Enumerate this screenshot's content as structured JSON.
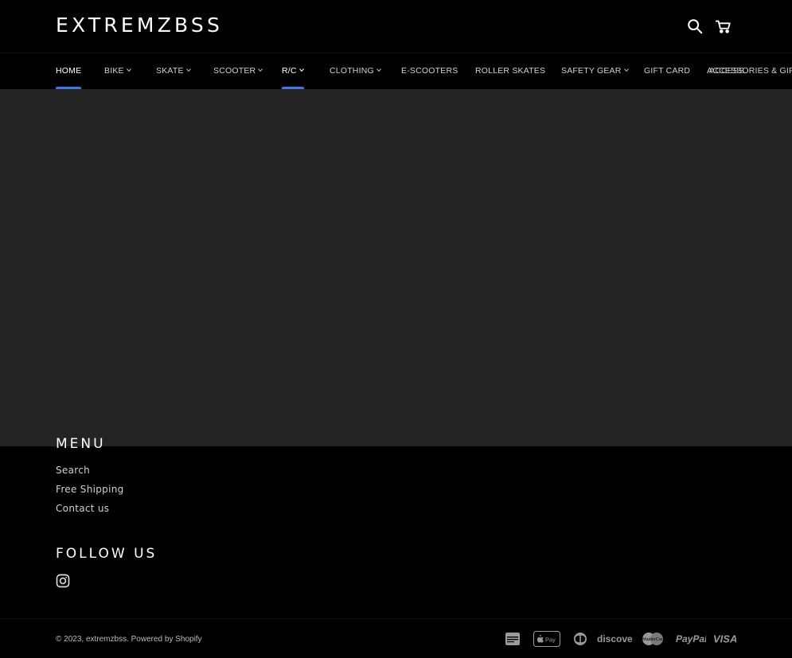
{
  "header": {
    "logo": "EXTREMZBSS",
    "icons": [
      "search-icon",
      "cart-icon"
    ]
  },
  "nav": {
    "items": [
      {
        "label": "HOME",
        "active": true,
        "dropdown": false
      },
      {
        "label": "BIKE",
        "active": false,
        "dropdown": true
      },
      {
        "label": "SKATE",
        "active": false,
        "dropdown": true
      },
      {
        "label": "SCOOTER",
        "active": false,
        "dropdown": true
      },
      {
        "label": "R/C",
        "active": true,
        "dropdown": true
      },
      {
        "label": "CLOTHING",
        "active": false,
        "dropdown": true
      },
      {
        "label": "E-SCOOTERS",
        "active": false,
        "dropdown": false
      },
      {
        "label": "ROLLER SKATES",
        "active": false,
        "dropdown": false
      },
      {
        "label": "SAFETY GEAR",
        "active": false,
        "dropdown": true
      },
      {
        "label": "GIFT CARD",
        "active": false,
        "dropdown": false
      },
      {
        "label": "ACCESSORIES & GIFTS",
        "active": false,
        "dropdown": false
      },
      {
        "label": "ACCESS",
        "active": false,
        "dropdown": false
      }
    ],
    "active_color": "#3d7ae8"
  },
  "footer": {
    "menu_heading": "MENU",
    "menu_links": [
      "Search",
      "Free Shipping",
      "Contact us"
    ],
    "follow_heading": "FOLLOW US",
    "social": [
      "instagram-icon"
    ],
    "copyright_prefix": "© 2023, ",
    "store_link": "extremzbss",
    "powered_by": ". Powered by Shopify",
    "payment_icons": [
      "american-express-icon",
      "apple-pay-icon",
      "diners-club-icon",
      "discover-icon",
      "mastercard-icon",
      "paypal-icon",
      "visa-icon"
    ]
  },
  "colors": {
    "background": "#000000",
    "main_area": "#242424",
    "accent": "#3d7ae8"
  }
}
